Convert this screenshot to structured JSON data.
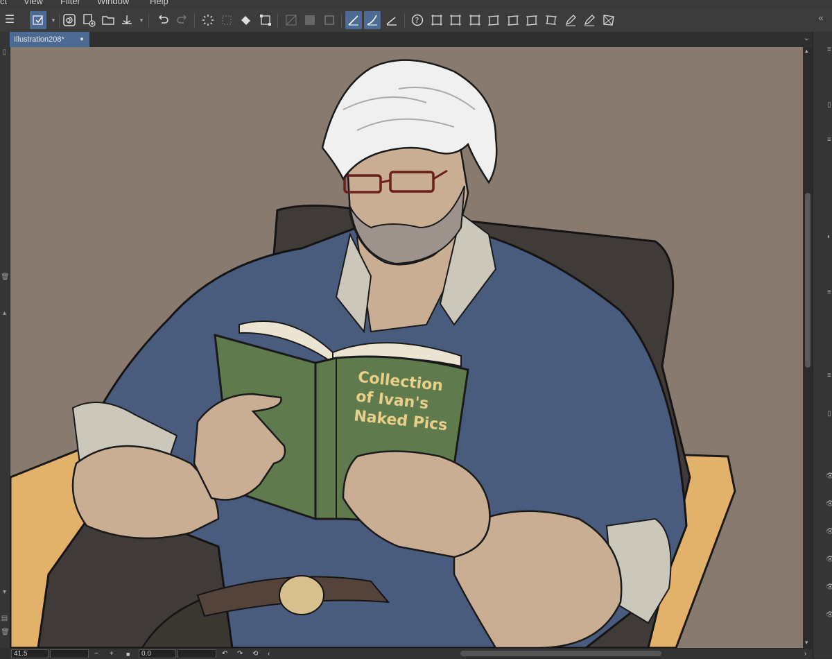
{
  "menu": {
    "items": [
      "ct",
      "View",
      "Filter",
      "Window",
      "Help"
    ]
  },
  "toolbar": {
    "menu_icon": "☰",
    "dropdown_glyph": "▾"
  },
  "document": {
    "tab_title": "Illustration208*",
    "tab_modified_dot": "●"
  },
  "artwork": {
    "book_title_lines": [
      "Collection",
      "of Ivan's",
      "Naked Pics"
    ]
  },
  "statusbar": {
    "zoom": "41.5",
    "angle": "0.0",
    "minus": "−",
    "plus": "+"
  },
  "colors": {
    "canvas_bg": "#887a6e",
    "chair": "#403a38",
    "shirt": "#4a5c7d",
    "skin": "#c9ae94",
    "book_cover": "#5f7a4c",
    "book_text": "#e8cf8a",
    "table": "#e2b16a",
    "hair": "#f0f0f0",
    "active_tab": "#4d6a93"
  }
}
